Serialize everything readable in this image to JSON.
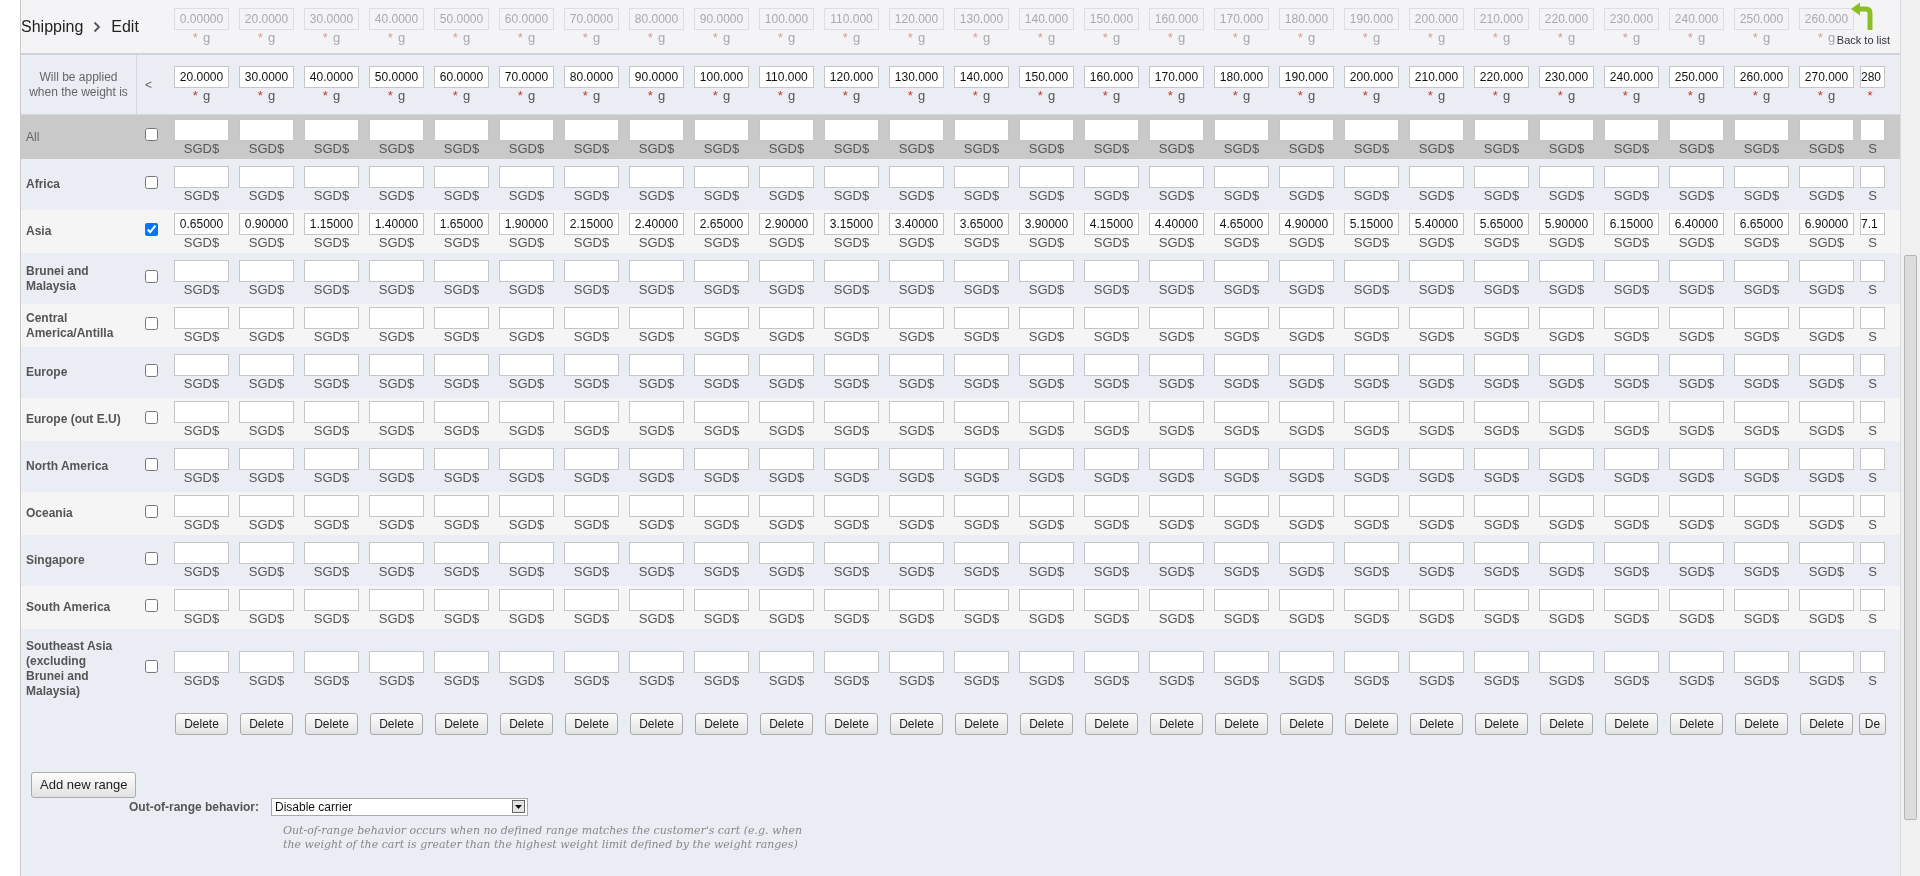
{
  "breadcrumb": {
    "section": "Shipping",
    "page": "Edit"
  },
  "back_button": {
    "label": "Back to list"
  },
  "faded_row": {
    "weights": [
      {
        "value": "0.00000",
        "mark": "*",
        "unit": "g"
      },
      {
        "value": "20.0000",
        "mark": "*",
        "unit": "g"
      },
      {
        "value": "30.0000",
        "mark": "*",
        "unit": "g"
      },
      {
        "value": "40.0000",
        "mark": "*",
        "unit": "g"
      },
      {
        "value": "50.0000",
        "mark": "*",
        "unit": "g"
      },
      {
        "value": "60.0000",
        "mark": "*",
        "unit": "g"
      },
      {
        "value": "70.0000",
        "mark": "*",
        "unit": "g"
      },
      {
        "value": "80.0000",
        "mark": "*",
        "unit": "g"
      },
      {
        "value": "90.0000",
        "mark": "*",
        "unit": "g"
      },
      {
        "value": "100.000",
        "mark": "*",
        "unit": "g"
      },
      {
        "value": "110.000",
        "mark": "*",
        "unit": "g"
      },
      {
        "value": "120.000",
        "mark": "*",
        "unit": "g"
      },
      {
        "value": "130.000",
        "mark": "*",
        "unit": "g"
      },
      {
        "value": "140.000",
        "mark": "*",
        "unit": "g"
      },
      {
        "value": "150.000",
        "mark": "*",
        "unit": "g"
      },
      {
        "value": "160.000",
        "mark": "*",
        "unit": "g"
      },
      {
        "value": "170.000",
        "mark": "*",
        "unit": "g"
      },
      {
        "value": "180.000",
        "mark": "*",
        "unit": "g"
      },
      {
        "value": "190.000",
        "mark": "*",
        "unit": "g"
      },
      {
        "value": "200.000",
        "mark": "*",
        "unit": "g"
      },
      {
        "value": "210.000",
        "mark": "*",
        "unit": "g"
      },
      {
        "value": "220.000",
        "mark": "*",
        "unit": "g"
      },
      {
        "value": "230.000",
        "mark": "*",
        "unit": "g"
      },
      {
        "value": "240.000",
        "mark": "*",
        "unit": "g"
      },
      {
        "value": "250.000",
        "mark": "*",
        "unit": "g"
      },
      {
        "value": "260.000",
        "mark": "*",
        "unit": "g"
      }
    ]
  },
  "range_header": {
    "label": "Will be applied when the weight is",
    "operator": "<",
    "weights": [
      {
        "value": "20.0000",
        "mark": "*",
        "unit": "g"
      },
      {
        "value": "30.0000",
        "mark": "*",
        "unit": "g"
      },
      {
        "value": "40.0000",
        "mark": "*",
        "unit": "g"
      },
      {
        "value": "50.0000",
        "mark": "*",
        "unit": "g"
      },
      {
        "value": "60.0000",
        "mark": "*",
        "unit": "g"
      },
      {
        "value": "70.0000",
        "mark": "*",
        "unit": "g"
      },
      {
        "value": "80.0000",
        "mark": "*",
        "unit": "g"
      },
      {
        "value": "90.0000",
        "mark": "*",
        "unit": "g"
      },
      {
        "value": "100.000",
        "mark": "*",
        "unit": "g"
      },
      {
        "value": "110.000",
        "mark": "*",
        "unit": "g"
      },
      {
        "value": "120.000",
        "mark": "*",
        "unit": "g"
      },
      {
        "value": "130.000",
        "mark": "*",
        "unit": "g"
      },
      {
        "value": "140.000",
        "mark": "*",
        "unit": "g"
      },
      {
        "value": "150.000",
        "mark": "*",
        "unit": "g"
      },
      {
        "value": "160.000",
        "mark": "*",
        "unit": "g"
      },
      {
        "value": "170.000",
        "mark": "*",
        "unit": "g"
      },
      {
        "value": "180.000",
        "mark": "*",
        "unit": "g"
      },
      {
        "value": "190.000",
        "mark": "*",
        "unit": "g"
      },
      {
        "value": "200.000",
        "mark": "*",
        "unit": "g"
      },
      {
        "value": "210.000",
        "mark": "*",
        "unit": "g"
      },
      {
        "value": "220.000",
        "mark": "*",
        "unit": "g"
      },
      {
        "value": "230.000",
        "mark": "*",
        "unit": "g"
      },
      {
        "value": "240.000",
        "mark": "*",
        "unit": "g"
      },
      {
        "value": "250.000",
        "mark": "*",
        "unit": "g"
      },
      {
        "value": "260.000",
        "mark": "*",
        "unit": "g"
      },
      {
        "value": "270.000",
        "mark": "*",
        "unit": "g"
      },
      {
        "value": "280",
        "mark": "*"
      }
    ]
  },
  "rows": [
    {
      "kind": "all",
      "zone": "All",
      "checked": false,
      "units": [
        "SGD$",
        "SGD$",
        "SGD$",
        "SGD$",
        "SGD$",
        "SGD$",
        "SGD$",
        "SGD$",
        "SGD$",
        "SGD$",
        "SGD$",
        "SGD$",
        "SGD$",
        "SGD$",
        "SGD$",
        "SGD$",
        "SGD$",
        "SGD$",
        "SGD$",
        "SGD$",
        "SGD$",
        "SGD$",
        "SGD$",
        "SGD$",
        "SGD$",
        "SGD$",
        "S"
      ]
    },
    {
      "kind": "zone",
      "zone": "Africa",
      "checked": false,
      "units": [
        "SGD$",
        "SGD$",
        "SGD$",
        "SGD$",
        "SGD$",
        "SGD$",
        "SGD$",
        "SGD$",
        "SGD$",
        "SGD$",
        "SGD$",
        "SGD$",
        "SGD$",
        "SGD$",
        "SGD$",
        "SGD$",
        "SGD$",
        "SGD$",
        "SGD$",
        "SGD$",
        "SGD$",
        "SGD$",
        "SGD$",
        "SGD$",
        "SGD$",
        "SGD$",
        "S"
      ]
    },
    {
      "kind": "zone",
      "zone": "Asia",
      "checked": true,
      "prices": [
        "0.65000",
        "0.90000",
        "1.15000",
        "1.40000",
        "1.65000",
        "1.90000",
        "2.15000",
        "2.40000",
        "2.65000",
        "2.90000",
        "3.15000",
        "3.40000",
        "3.65000",
        "3.90000",
        "4.15000",
        "4.40000",
        "4.65000",
        "4.90000",
        "5.15000",
        "5.40000",
        "5.65000",
        "5.90000",
        "6.15000",
        "6.40000",
        "6.65000",
        "6.90000",
        "7.1"
      ],
      "units": [
        "SGD$",
        "SGD$",
        "SGD$",
        "SGD$",
        "SGD$",
        "SGD$",
        "SGD$",
        "SGD$",
        "SGD$",
        "SGD$",
        "SGD$",
        "SGD$",
        "SGD$",
        "SGD$",
        "SGD$",
        "SGD$",
        "SGD$",
        "SGD$",
        "SGD$",
        "SGD$",
        "SGD$",
        "SGD$",
        "SGD$",
        "SGD$",
        "SGD$",
        "SGD$",
        "S"
      ]
    },
    {
      "kind": "zone",
      "zone": "Brunei and Malaysia",
      "checked": false,
      "units": [
        "SGD$",
        "SGD$",
        "SGD$",
        "SGD$",
        "SGD$",
        "SGD$",
        "SGD$",
        "SGD$",
        "SGD$",
        "SGD$",
        "SGD$",
        "SGD$",
        "SGD$",
        "SGD$",
        "SGD$",
        "SGD$",
        "SGD$",
        "SGD$",
        "SGD$",
        "SGD$",
        "SGD$",
        "SGD$",
        "SGD$",
        "SGD$",
        "SGD$",
        "SGD$",
        "S"
      ]
    },
    {
      "kind": "zone",
      "zone": "Central America/Antilla",
      "checked": false,
      "units": [
        "SGD$",
        "SGD$",
        "SGD$",
        "SGD$",
        "SGD$",
        "SGD$",
        "SGD$",
        "SGD$",
        "SGD$",
        "SGD$",
        "SGD$",
        "SGD$",
        "SGD$",
        "SGD$",
        "SGD$",
        "SGD$",
        "SGD$",
        "SGD$",
        "SGD$",
        "SGD$",
        "SGD$",
        "SGD$",
        "SGD$",
        "SGD$",
        "SGD$",
        "SGD$",
        "S"
      ]
    },
    {
      "kind": "zone",
      "zone": "Europe",
      "checked": false,
      "units": [
        "SGD$",
        "SGD$",
        "SGD$",
        "SGD$",
        "SGD$",
        "SGD$",
        "SGD$",
        "SGD$",
        "SGD$",
        "SGD$",
        "SGD$",
        "SGD$",
        "SGD$",
        "SGD$",
        "SGD$",
        "SGD$",
        "SGD$",
        "SGD$",
        "SGD$",
        "SGD$",
        "SGD$",
        "SGD$",
        "SGD$",
        "SGD$",
        "SGD$",
        "SGD$",
        "S"
      ]
    },
    {
      "kind": "zone",
      "zone": "Europe (out E.U)",
      "checked": false,
      "units": [
        "SGD$",
        "SGD$",
        "SGD$",
        "SGD$",
        "SGD$",
        "SGD$",
        "SGD$",
        "SGD$",
        "SGD$",
        "SGD$",
        "SGD$",
        "SGD$",
        "SGD$",
        "SGD$",
        "SGD$",
        "SGD$",
        "SGD$",
        "SGD$",
        "SGD$",
        "SGD$",
        "SGD$",
        "SGD$",
        "SGD$",
        "SGD$",
        "SGD$",
        "SGD$",
        "S"
      ]
    },
    {
      "kind": "zone",
      "zone": "North America",
      "checked": false,
      "units": [
        "SGD$",
        "SGD$",
        "SGD$",
        "SGD$",
        "SGD$",
        "SGD$",
        "SGD$",
        "SGD$",
        "SGD$",
        "SGD$",
        "SGD$",
        "SGD$",
        "SGD$",
        "SGD$",
        "SGD$",
        "SGD$",
        "SGD$",
        "SGD$",
        "SGD$",
        "SGD$",
        "SGD$",
        "SGD$",
        "SGD$",
        "SGD$",
        "SGD$",
        "SGD$",
        "S"
      ]
    },
    {
      "kind": "zone",
      "zone": "Oceania",
      "checked": false,
      "units": [
        "SGD$",
        "SGD$",
        "SGD$",
        "SGD$",
        "SGD$",
        "SGD$",
        "SGD$",
        "SGD$",
        "SGD$",
        "SGD$",
        "SGD$",
        "SGD$",
        "SGD$",
        "SGD$",
        "SGD$",
        "SGD$",
        "SGD$",
        "SGD$",
        "SGD$",
        "SGD$",
        "SGD$",
        "SGD$",
        "SGD$",
        "SGD$",
        "SGD$",
        "SGD$",
        "S"
      ]
    },
    {
      "kind": "zone",
      "zone": "Singapore",
      "checked": false,
      "units": [
        "SGD$",
        "SGD$",
        "SGD$",
        "SGD$",
        "SGD$",
        "SGD$",
        "SGD$",
        "SGD$",
        "SGD$",
        "SGD$",
        "SGD$",
        "SGD$",
        "SGD$",
        "SGD$",
        "SGD$",
        "SGD$",
        "SGD$",
        "SGD$",
        "SGD$",
        "SGD$",
        "SGD$",
        "SGD$",
        "SGD$",
        "SGD$",
        "SGD$",
        "SGD$",
        "S"
      ]
    },
    {
      "kind": "zone",
      "zone": "South America",
      "checked": false,
      "units": [
        "SGD$",
        "SGD$",
        "SGD$",
        "SGD$",
        "SGD$",
        "SGD$",
        "SGD$",
        "SGD$",
        "SGD$",
        "SGD$",
        "SGD$",
        "SGD$",
        "SGD$",
        "SGD$",
        "SGD$",
        "SGD$",
        "SGD$",
        "SGD$",
        "SGD$",
        "SGD$",
        "SGD$",
        "SGD$",
        "SGD$",
        "SGD$",
        "SGD$",
        "SGD$",
        "S"
      ]
    },
    {
      "kind": "zone",
      "zone": "Southeast Asia (excluding Brunei and Malaysia)",
      "checked": false,
      "units": [
        "SGD$",
        "SGD$",
        "SGD$",
        "SGD$",
        "SGD$",
        "SGD$",
        "SGD$",
        "SGD$",
        "SGD$",
        "SGD$",
        "SGD$",
        "SGD$",
        "SGD$",
        "SGD$",
        "SGD$",
        "SGD$",
        "SGD$",
        "SGD$",
        "SGD$",
        "SGD$",
        "SGD$",
        "SGD$",
        "SGD$",
        "SGD$",
        "SGD$",
        "SGD$",
        "S"
      ]
    }
  ],
  "delete_buttons": [
    "Delete",
    "Delete",
    "Delete",
    "Delete",
    "Delete",
    "Delete",
    "Delete",
    "Delete",
    "Delete",
    "Delete",
    "Delete",
    "Delete",
    "Delete",
    "Delete",
    "Delete",
    "Delete",
    "Delete",
    "Delete",
    "Delete",
    "Delete",
    "Delete",
    "Delete",
    "Delete",
    "Delete",
    "Delete",
    "Delete",
    "De"
  ],
  "add_range_button": "Add new range",
  "out_of_range": {
    "label": "Out-of-range behavior:",
    "value": "Disable carrier",
    "help": "Out-of-range behavior occurs when no defined range matches the customer's cart (e.g. when the weight of the cart is greater than the highest weight limit defined by the weight ranges)"
  }
}
